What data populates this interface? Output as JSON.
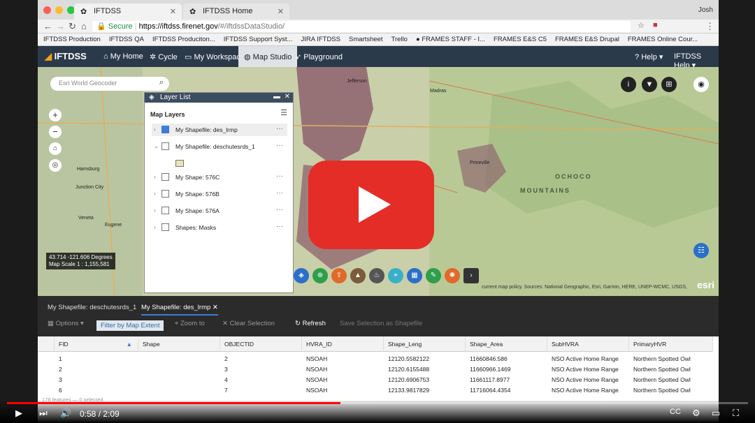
{
  "browser": {
    "tabs": [
      {
        "label": "IFTDSS"
      },
      {
        "label": "IFTDSS Home"
      }
    ],
    "user": "Josh",
    "address": {
      "secure": "Secure",
      "domain": "https://iftdss.firenet.gov",
      "path": "/#/iftdssDataStudio/"
    },
    "bookmarks": [
      "IFTDSS Production",
      "IFTDSS QA",
      "IFTDSS Produciton...",
      "IFTDSS Support Syst...",
      "JIRA IFTDSS",
      "Smartsheet",
      "Trello",
      "● FRAMES STAFF - I...",
      "FRAMES E&S C5",
      "FRAMES E&S Drupal",
      "FRAMES Online Cour..."
    ]
  },
  "app": {
    "logo": "IFTDSS",
    "nav": [
      "My Home",
      "Cycle",
      "My Workspace",
      "Map Studio",
      "Playground"
    ],
    "right": [
      "Help ▾",
      "IFTDSS Help ▾"
    ]
  },
  "map": {
    "geocoder_placeholder": "Esri World Geocoder",
    "coords": "43.714 -121.606 Degrees",
    "scale": "Map Scale 1 : 1,155,581",
    "attribution": "current map policy. Sources: National Geographic, Esri, Garmin, HERE, UNEP-WCMC, USGS,",
    "esri": "esri",
    "labels": [
      "Hamsburg",
      "Junction City",
      "Veneta",
      "Eugene",
      "Jefferson",
      "Madras",
      "OCHOCO",
      "MOUNTAINS",
      "Prineville"
    ]
  },
  "layer_list": {
    "title": "Layer List",
    "section": "Map Layers",
    "layers": [
      {
        "label": "My Shapefile: des_lrmp",
        "checked": true
      },
      {
        "label": "My Shapefile: deschutesrds_1",
        "checked": false
      },
      {
        "label": "My Shape: 576C",
        "checked": false
      },
      {
        "label": "My Shape: 576B",
        "checked": false
      },
      {
        "label": "My Shape: 576A",
        "checked": false
      },
      {
        "label": "Shapes: Masks",
        "checked": false
      }
    ]
  },
  "attribute_table": {
    "tabs": [
      "My Shapefile: deschutesrds_1",
      "My Shapefile: des_lrmp"
    ],
    "tools": [
      "Options",
      "Filter by Map Extent",
      "Zoom to",
      "Clear Selection",
      "Refresh",
      "Save Selection as Shapefile"
    ],
    "columns": [
      "FID",
      "Shape",
      "OBJECTID",
      "HVRA_ID",
      "Shape_Leng",
      "Shape_Area",
      "SubHVRA",
      "PrimaryHVR"
    ],
    "rows": [
      [
        "1",
        "",
        "2",
        "NSOAH",
        "12120.5582122",
        "11660846.586",
        "NSO Active Home Range",
        "Northern Spotted Owl"
      ],
      [
        "2",
        "",
        "3",
        "NSOAH",
        "12120.6155488",
        "11660966.1469",
        "NSO Active Home Range",
        "Northern Spotted Owl"
      ],
      [
        "3",
        "",
        "4",
        "NSOAH",
        "12120.6906753",
        "11661117.8977",
        "NSO Active Home Range",
        "Northern Spotted Owl"
      ],
      [
        "6",
        "",
        "7",
        "NSOAH",
        "12133.9817829",
        "11716064.4354",
        "NSO Active Home Range",
        "Northern Spotted Owl"
      ]
    ],
    "status": "178 features — 0 selected"
  },
  "player": {
    "time": "0:58 / 2:09",
    "progress": 0.45
  }
}
